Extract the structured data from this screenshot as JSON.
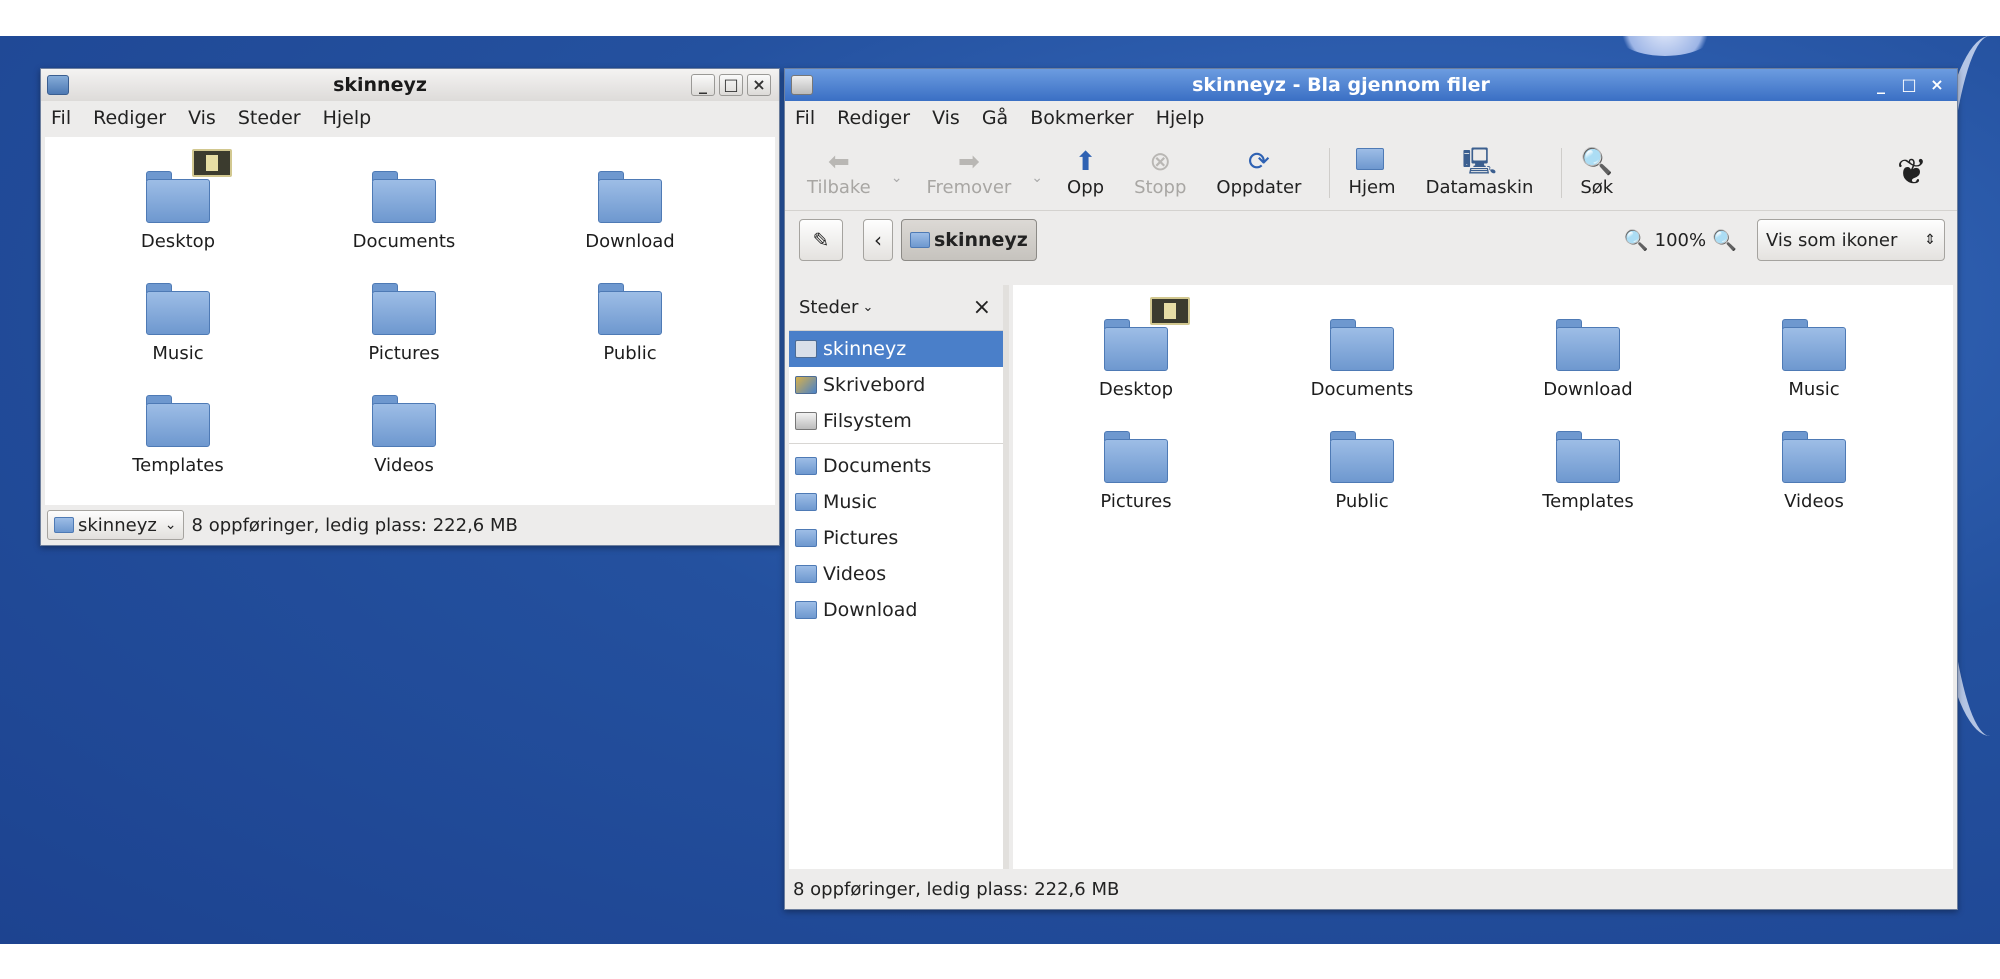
{
  "left_window": {
    "title": "skinneyz",
    "menu": [
      "Fil",
      "Rediger",
      "Vis",
      "Steder",
      "Hjelp"
    ],
    "icons": [
      {
        "label": "Desktop",
        "emblem": true
      },
      {
        "label": "Documents"
      },
      {
        "label": "Download"
      },
      {
        "label": "Music"
      },
      {
        "label": "Pictures"
      },
      {
        "label": "Public"
      },
      {
        "label": "Templates"
      },
      {
        "label": "Videos"
      }
    ],
    "location_selector": "skinneyz",
    "status": "8 oppføringer, ledig plass: 222,6 MB"
  },
  "right_window": {
    "title": "skinneyz - Bla gjennom filer",
    "menu": [
      "Fil",
      "Rediger",
      "Vis",
      "Gå",
      "Bokmerker",
      "Hjelp"
    ],
    "toolbar": {
      "back": "Tilbake",
      "forward": "Fremover",
      "up": "Opp",
      "stop": "Stopp",
      "reload": "Oppdater",
      "home": "Hjem",
      "computer": "Datamaskin",
      "search": "Søk"
    },
    "breadcrumb": "skinneyz",
    "zoom": "100%",
    "view_mode": "Vis som ikoner",
    "sidebar": {
      "header": "Steder",
      "places": [
        {
          "label": "skinneyz",
          "icon": "home-icon",
          "selected": true
        },
        {
          "label": "Skrivebord",
          "icon": "desktop-icon"
        },
        {
          "label": "Filsystem",
          "icon": "filesystem-icon"
        }
      ],
      "bookmarks": [
        {
          "label": "Documents"
        },
        {
          "label": "Music"
        },
        {
          "label": "Pictures"
        },
        {
          "label": "Videos"
        },
        {
          "label": "Download"
        }
      ]
    },
    "icons": [
      {
        "label": "Desktop",
        "emblem": true
      },
      {
        "label": "Documents"
      },
      {
        "label": "Download"
      },
      {
        "label": "Music"
      },
      {
        "label": "Pictures"
      },
      {
        "label": "Public"
      },
      {
        "label": "Templates"
      },
      {
        "label": "Videos"
      }
    ],
    "status": "8 oppføringer, ledig plass: 222,6 MB"
  },
  "colors": {
    "desktop_blue": "#24519f",
    "title_active": "#3a6fc4",
    "selection": "#4a7fc9",
    "folder": "#6e98cf"
  }
}
